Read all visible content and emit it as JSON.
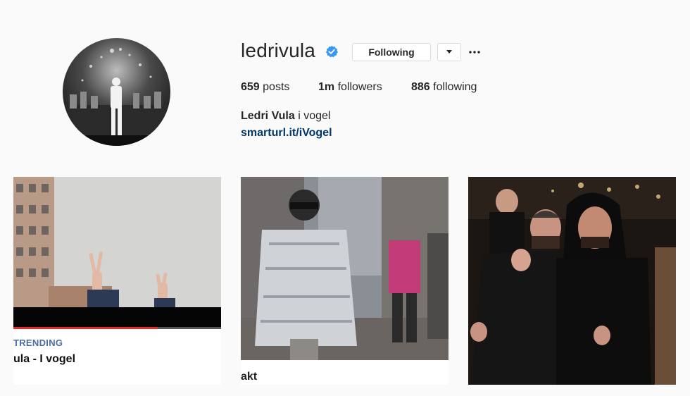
{
  "profile": {
    "username": "ledrivula",
    "verified": true,
    "follow_button": "Following",
    "dropdown_icon": "caret-down-icon",
    "more_icon": "ellipsis-icon"
  },
  "stats": {
    "posts_count": "659",
    "posts_label": "posts",
    "followers_count": "1m",
    "followers_label": "followers",
    "following_count": "886",
    "following_label": "following"
  },
  "bio": {
    "name": "Ledri Vula",
    "text": "i vogel",
    "link": "smarturl.it/iVogel"
  },
  "posts": [
    {
      "overlay_label": "TRENDING",
      "overlay_title": "ula - I vogel"
    },
    {
      "overlay_title": "akt"
    },
    {
      "overlay_title": ""
    }
  ],
  "colors": {
    "background": "#fafafa",
    "verified_blue": "#3897f0",
    "link": "#003569",
    "border": "#dbdbdb"
  }
}
